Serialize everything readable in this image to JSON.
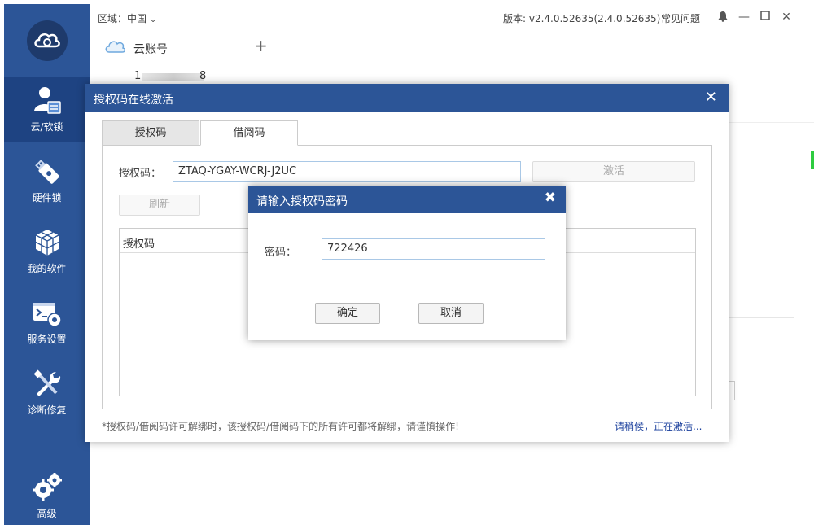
{
  "topbar": {
    "region_label": "区域：中国",
    "version_label": "版本: v2.4.0.52635(2.4.0.52635)",
    "faq_label": "常见问题"
  },
  "sidebar": {
    "items": [
      {
        "label": "云/软锁",
        "icon": "user-card-icon",
        "active": true
      },
      {
        "label": "硬件锁",
        "icon": "usb-key-icon",
        "active": false
      },
      {
        "label": "我的软件",
        "icon": "cubes-icon",
        "active": false
      },
      {
        "label": "服务设置",
        "icon": "terminal-gear-icon",
        "active": false
      },
      {
        "label": "诊断修复",
        "icon": "wrench-screwdriver-icon",
        "active": false
      },
      {
        "label": "高级",
        "icon": "gears-icon",
        "active": false
      }
    ]
  },
  "account": {
    "title": "云账号",
    "add_label": "+",
    "account_id_start": "1",
    "account_id_end": "8"
  },
  "activation_dialog": {
    "title": "授权码在线激活",
    "tabs": [
      "授权码",
      "借阅码"
    ],
    "code_label": "授权码：",
    "code_value": "ZTAQ-YGAY-WCRJ-J2UC",
    "activate_label": "激活",
    "refresh_label": "刷新",
    "list_header": "授权码",
    "warning": "*授权码/借阅码许可解绑时，该授权码/借阅码下的所有许可都将解绑，请谨慎操作!",
    "status": "请稍候，正在激活..."
  },
  "password_dialog": {
    "title": "请输入授权码密码",
    "password_label": "密码：",
    "password_value": "722426",
    "ok_label": "确定",
    "cancel_label": "取消"
  },
  "colors": {
    "brand": "#2c5597",
    "brand_dark": "#1e4382",
    "status_link": "#1a3f9c"
  }
}
